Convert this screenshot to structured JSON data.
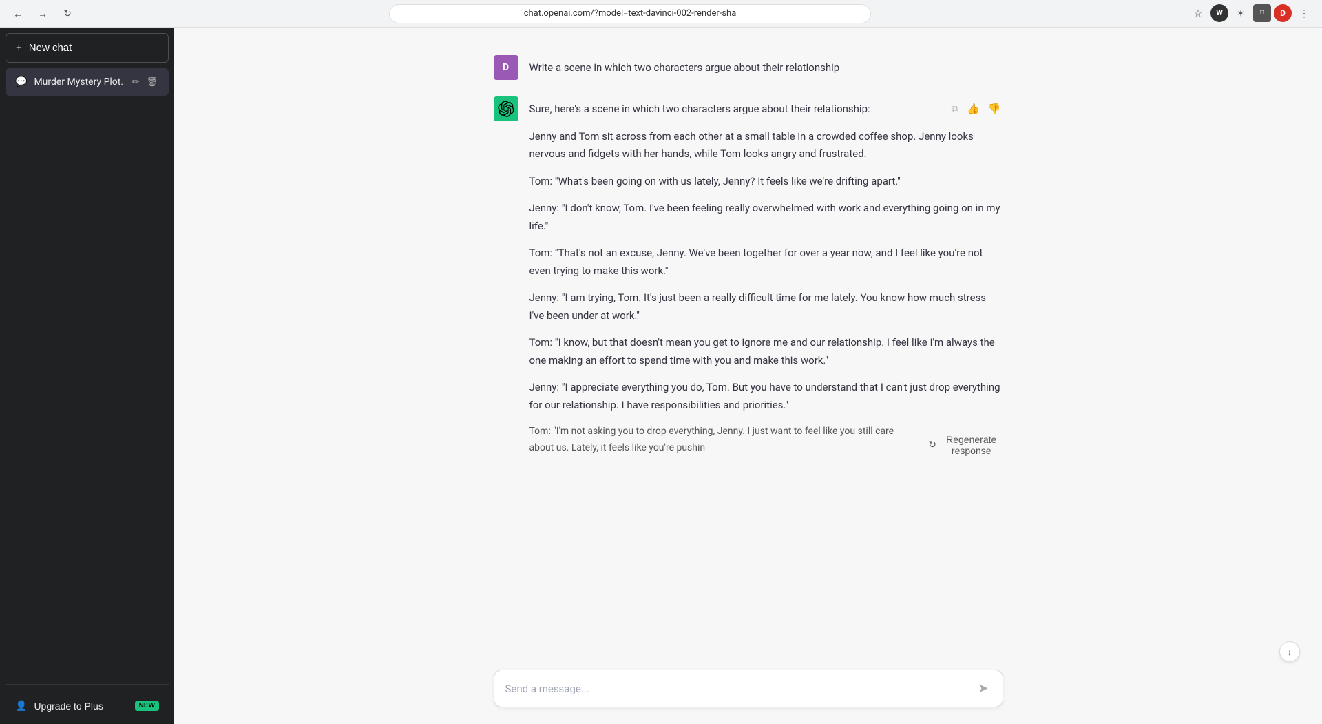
{
  "browser": {
    "url": "chat.openai.com/?model=text-davinci-002-render-sha",
    "back_label": "←",
    "forward_label": "→",
    "reload_label": "↻",
    "profile_initial": "D",
    "ext1_label": "W",
    "ext2_label": "⊞",
    "ext3_label": "✶",
    "ext4_label": "□",
    "more_label": "⋮"
  },
  "sidebar": {
    "new_chat_label": "New chat",
    "new_chat_icon": "+",
    "chat_icon": "💬",
    "chat_item_label": "Murder Mystery Plot.",
    "edit_icon": "✏",
    "delete_icon": "🗑",
    "upgrade_label": "Upgrade to Plus",
    "upgrade_icon": "👤",
    "new_badge": "NEW"
  },
  "chat": {
    "user_initial": "D",
    "user_prompt": "Write a scene in which two characters argue about their relationship",
    "assistant_response": {
      "intro": "Sure, here's a scene in which two characters argue about their relationship:",
      "paragraphs": [
        "Jenny and Tom sit across from each other at a small table in a crowded coffee shop. Jenny looks nervous and fidgets with her hands, while Tom looks angry and frustrated.",
        "Tom: \"What's been going on with us lately, Jenny? It feels like we're drifting apart.\"",
        "Jenny: \"I don't know, Tom. I've been feeling really overwhelmed with work and everything going on in my life.\"",
        "Tom: \"That's not an excuse, Jenny. We've been together for over a year now, and I feel like you're not even trying to make this work.\"",
        "Jenny: \"I am trying, Tom. It's just been a really difficult time for me lately. You know how much stress I've been under at work.\"",
        "Tom: \"I know, but that doesn't mean you get to ignore me and our relationship. I feel like I'm always the one making an effort to spend time with you and make this work.\"",
        "Jenny: \"I appreciate everything you do, Tom. But you have to understand that I can't just drop everything for our relationship. I have responsibilities and priorities.\"",
        "Tom: \"I'm not asking you to drop everything, Jenny. I just want to feel like you still care about us. Lately, it feels like you're pushin"
      ]
    },
    "copy_icon": "⧉",
    "thumbup_icon": "👍",
    "thumbdown_icon": "👎",
    "regenerate_label": "Regenerate response",
    "regenerate_icon": "↻",
    "input_placeholder": "Send a message...",
    "send_icon": "➤",
    "scroll_down_icon": "↓"
  }
}
